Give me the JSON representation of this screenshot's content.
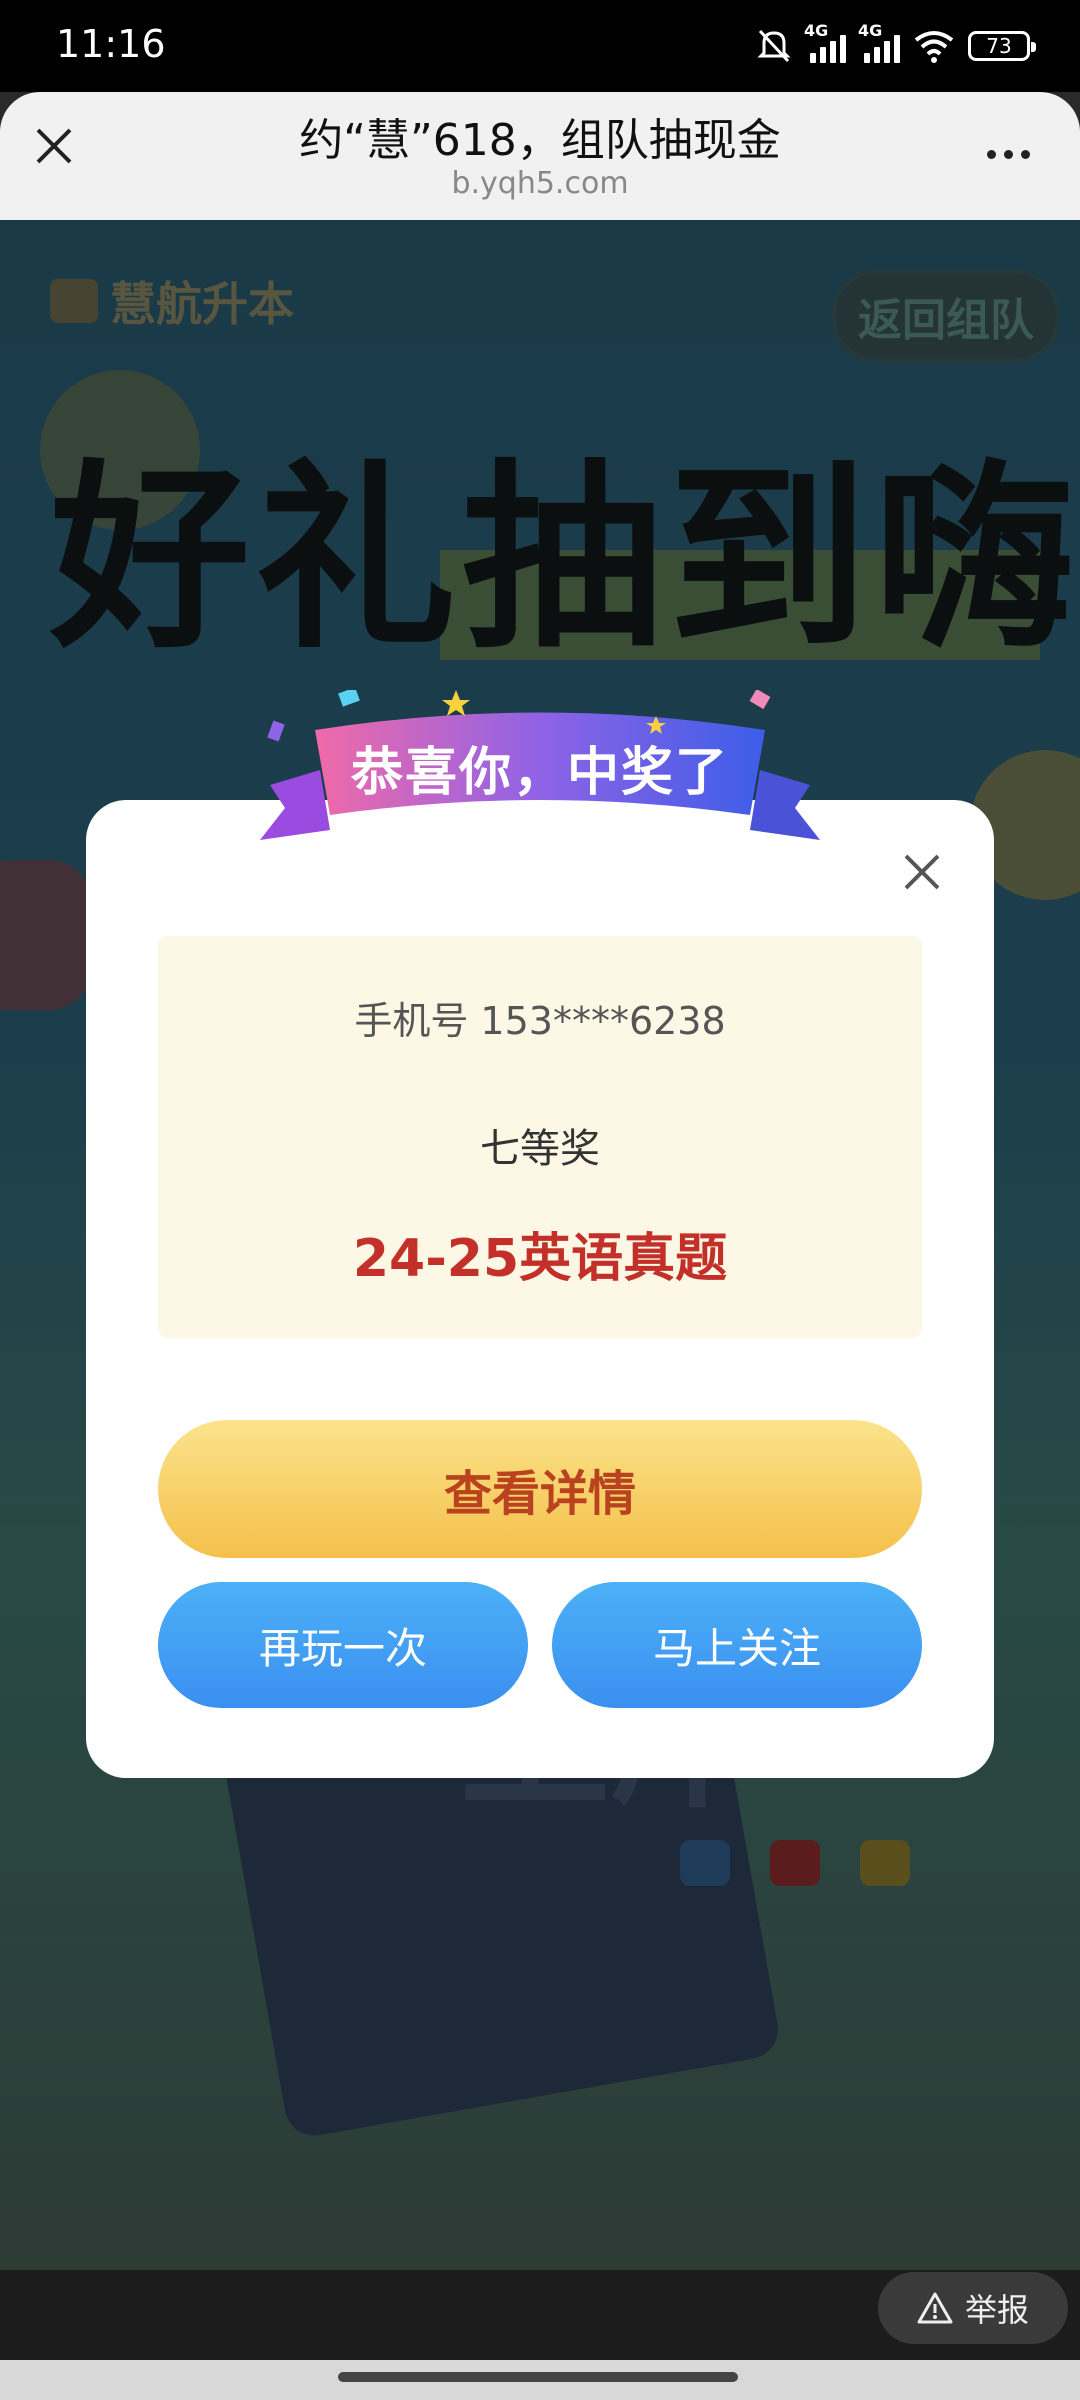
{
  "status_bar": {
    "time": "11:16",
    "network1": "4G",
    "network2": "4G",
    "battery": "73"
  },
  "browser": {
    "title": "约“慧”618，组队抽现金",
    "url": "b.yqh5.com"
  },
  "background": {
    "brand": "慧航升本",
    "return_button": "返回组队",
    "headline": "好礼抽到嗨",
    "book_text": "上岸"
  },
  "modal": {
    "banner": "恭喜你，中奖了",
    "phone": "手机号 153****6238",
    "tier": "七等奖",
    "prize": "24-25英语真题",
    "detail_button": "查看详情",
    "replay_button": "再玩一次",
    "follow_button": "马上关注"
  },
  "footer": {
    "report": "举报"
  },
  "colors": {
    "prize_text": "#c3302a",
    "detail_button": "#f4c04a",
    "action_button": "#3a8ff0",
    "prize_box_bg": "#fdf8e6"
  }
}
